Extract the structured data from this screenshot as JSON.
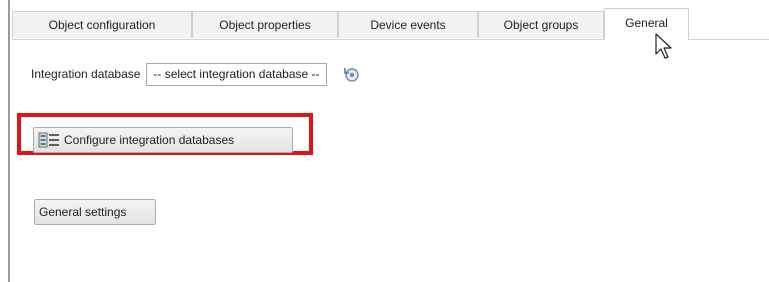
{
  "tabs": [
    {
      "label": "Object configuration"
    },
    {
      "label": "Object properties"
    },
    {
      "label": "Device events"
    },
    {
      "label": "Object groups"
    },
    {
      "label": "General"
    }
  ],
  "active_tab": "General",
  "integration": {
    "label": "Integration database",
    "select_value": "-- select integration database --",
    "refresh_icon": "refresh-icon"
  },
  "buttons": {
    "configure_label": "Configure integration databases",
    "configure_icon": "database-list-icon",
    "general_settings_label": "General settings"
  },
  "colors": {
    "highlight": "#e01414"
  }
}
